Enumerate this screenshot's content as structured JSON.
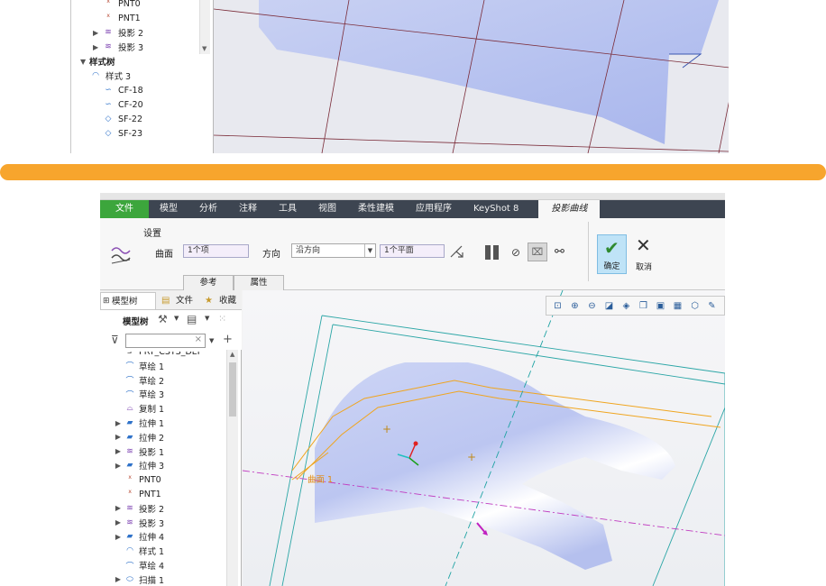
{
  "top": {
    "tree_items": [
      {
        "label": "PNT0",
        "icon": "point-icon",
        "toggle": ""
      },
      {
        "label": "PNT1",
        "icon": "point-icon",
        "toggle": ""
      },
      {
        "label": "投影 2",
        "icon": "projection-icon",
        "toggle": "▶"
      },
      {
        "label": "投影 3",
        "icon": "projection-icon",
        "toggle": "▶"
      },
      {
        "label": "样式树",
        "icon": "",
        "toggle": "▼",
        "bold": true
      },
      {
        "label": "样式 3",
        "icon": "style-icon",
        "toggle": ""
      },
      {
        "label": "CF-18",
        "icon": "curve-icon",
        "toggle": ""
      },
      {
        "label": "CF-20",
        "icon": "curve-icon",
        "toggle": ""
      },
      {
        "label": "SF-22",
        "icon": "surface-icon",
        "toggle": ""
      },
      {
        "label": "SF-23",
        "icon": "surface-icon",
        "toggle": ""
      }
    ]
  },
  "ribbon": {
    "tabs": [
      "文件",
      "模型",
      "分析",
      "注释",
      "工具",
      "视图",
      "柔性建模",
      "应用程序",
      "KeyShot 8"
    ],
    "active_tab": "投影曲线",
    "group_title": "设置",
    "surface_label": "曲面",
    "surface_value": "1个项",
    "direction_label": "方向",
    "direction_value": "沿方向",
    "plane_value": "1个平面",
    "subtabs": [
      "参考",
      "属性"
    ],
    "ok_label": "确定",
    "cancel_label": "取消",
    "colors": {
      "tab_bar": "#3d4551",
      "file_tab": "#3ca63c",
      "ok_box": "#bfe3f7",
      "accent": "#f7a52d"
    }
  },
  "tree": {
    "tabs": [
      "模型树",
      "文件",
      "收藏"
    ],
    "toolbar_label": "模型树",
    "items": [
      {
        "label": "PRT_CSYS_DEF",
        "icon": "csys-icon",
        "toggle": ""
      },
      {
        "label": "草绘 1",
        "icon": "sketch-icon",
        "toggle": ""
      },
      {
        "label": "草绘 2",
        "icon": "sketch-icon",
        "toggle": ""
      },
      {
        "label": "草绘 3",
        "icon": "sketch-icon",
        "toggle": ""
      },
      {
        "label": "复制 1",
        "icon": "copy-icon",
        "toggle": ""
      },
      {
        "label": "拉伸 1",
        "icon": "extrude-icon",
        "toggle": "▶"
      },
      {
        "label": "拉伸 2",
        "icon": "extrude-icon",
        "toggle": "▶"
      },
      {
        "label": "投影 1",
        "icon": "projection-icon",
        "toggle": "▶"
      },
      {
        "label": "拉伸 3",
        "icon": "extrude-icon",
        "toggle": "▶"
      },
      {
        "label": "PNT0",
        "icon": "point-icon",
        "toggle": ""
      },
      {
        "label": "PNT1",
        "icon": "point-icon",
        "toggle": ""
      },
      {
        "label": "投影 2",
        "icon": "projection-icon",
        "toggle": "▶"
      },
      {
        "label": "投影 3",
        "icon": "projection-icon",
        "toggle": "▶"
      },
      {
        "label": "拉伸 4",
        "icon": "extrude-icon",
        "toggle": "▶"
      },
      {
        "label": "样式 1",
        "icon": "style-icon",
        "toggle": ""
      },
      {
        "label": "草绘 4",
        "icon": "sketch-icon",
        "toggle": ""
      },
      {
        "label": "扫描 1",
        "icon": "sweep-icon",
        "toggle": "▶"
      }
    ]
  },
  "viewport": {
    "annotation_label": "曲面 1"
  }
}
